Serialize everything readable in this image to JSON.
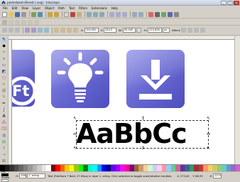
{
  "window": {
    "title": "posterbanh-Bereit (.svg) - Inkscape",
    "buttons": {
      "minimize": "_",
      "maximize": "□",
      "close": "×"
    }
  },
  "menu": [
    "File",
    "Edit",
    "View",
    "Layer",
    "Object",
    "Path",
    "Text",
    "Filters",
    "Extensions",
    "Help"
  ],
  "controls": {
    "x_label": "X:",
    "x_value": "104.561",
    "y_label": "Y:",
    "y_value": "244.5",
    "w_label": "W:",
    "w_value": "90.940",
    "h_label": "H:",
    "h_value": "223.826",
    "unit": "px",
    "affect_label": "Affect:"
  },
  "canvas": {
    "tiles": [
      {
        "name": "tile-ft",
        "text": "Ft",
        "icon": "ft-letter-icon"
      },
      {
        "name": "tile-lightbulb",
        "icon": "lightbulb-icon"
      },
      {
        "name": "tile-download",
        "icon": "download-icon"
      }
    ],
    "sample_text": "AaBbCc",
    "handles": {
      "corner": "↖",
      "side": "↔",
      "vertical": "↕"
    }
  },
  "status": {
    "fill_label": "Fill:",
    "stroke_label": "Stroke:",
    "opacity_label": "O:",
    "opacity_value": "100",
    "layer": "1. erling",
    "message": "Text (FreeSans 7 Bold, 27.00px) in layer 1. erling. Click selection to toggle scale/rotation handles.",
    "x_coord": "X: 273,40",
    "y_coord": "Y: 88,93",
    "zoom_label": "Z:",
    "zoom_value": "127%"
  },
  "colors": {
    "accent": "#6b6bd4",
    "palette": [
      "#000000",
      "#1a1a1a",
      "#333333",
      "#4d4d4d",
      "#666666",
      "#808080",
      "#999999",
      "#b3b3b3",
      "#cccccc",
      "#e6e6e6",
      "#ffffff",
      "#800000",
      "#ff0000",
      "#ff6600",
      "#ffcc00",
      "#ffff00",
      "#99cc00",
      "#00ff00",
      "#008000",
      "#00ffcc",
      "#00ffff",
      "#0099ff",
      "#0000ff",
      "#000080",
      "#6600ff",
      "#9900ff",
      "#ff00ff",
      "#ff0099",
      "#800080",
      "#996633",
      "#cc9966",
      "#ffcc99",
      "#ccffcc",
      "#ccccff",
      "#ffccff",
      "#ff9999",
      "#99ccff",
      "#66cc99",
      "#cc6699",
      "#663399",
      "#336699",
      "#339966",
      "#993333",
      "#cc3333",
      "#ff9966",
      "#ffcc66",
      "#cccc66",
      "#99cc66",
      "#66cccc",
      "#6699cc",
      "#9966cc",
      "#cc66cc"
    ]
  }
}
